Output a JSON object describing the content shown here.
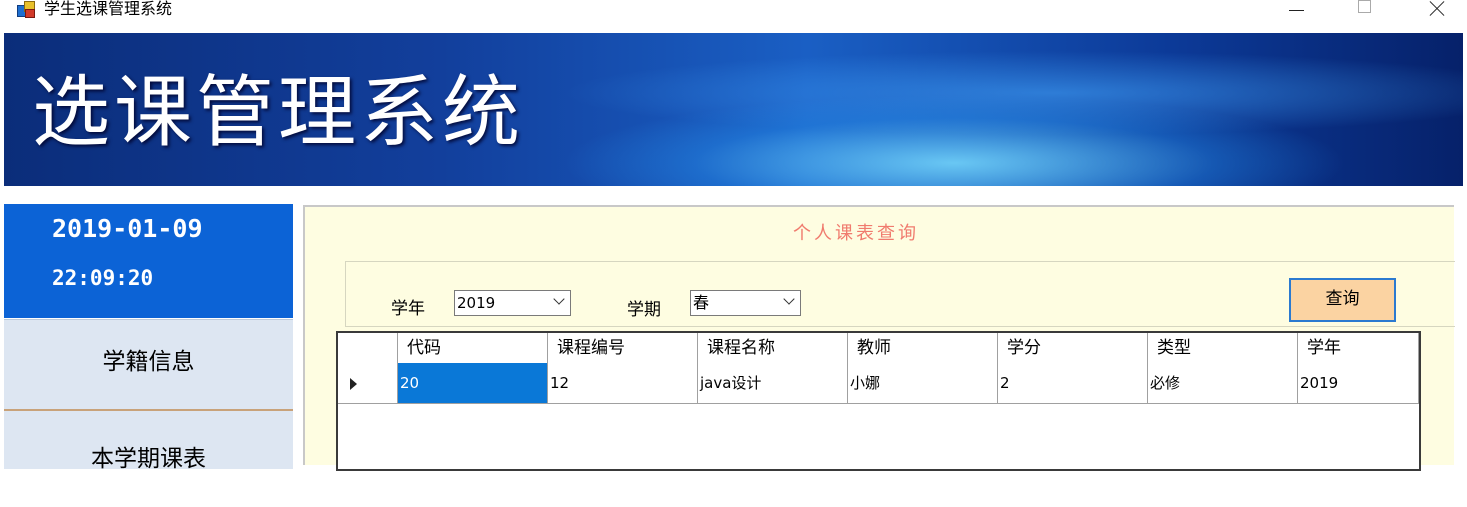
{
  "window": {
    "title": "学生选课管理系统"
  },
  "banner": {
    "title": "选课管理系统"
  },
  "sidebar": {
    "date": "2019-01-09",
    "time": "22:09:20",
    "items": [
      {
        "label": "学籍信息"
      },
      {
        "label": "本学期课表"
      }
    ]
  },
  "main": {
    "title": "个人课表查询",
    "filters": {
      "year_label": "学年",
      "year_value": "2019",
      "term_label": "学期",
      "term_value": "春",
      "query_label": "查询"
    },
    "table": {
      "columns": [
        "代码",
        "课程编号",
        "课程名称",
        "教师",
        "学分",
        "类型",
        "学年"
      ],
      "rows": [
        [
          "20",
          "12",
          "java设计",
          "小娜",
          "2",
          "必修",
          "2019"
        ]
      ]
    }
  },
  "colors": {
    "banner_blue": "#123f9c",
    "clock_blue": "#0c63d6",
    "panel_bg": "#fefde1",
    "title_accent": "#f07b6e",
    "button_bg": "#fbd3a2",
    "selection": "#0a78d7"
  },
  "icons": [
    "app-icon",
    "minimize-icon",
    "maximize-icon",
    "close-icon",
    "chevron-down-icon",
    "row-selector-icon"
  ]
}
